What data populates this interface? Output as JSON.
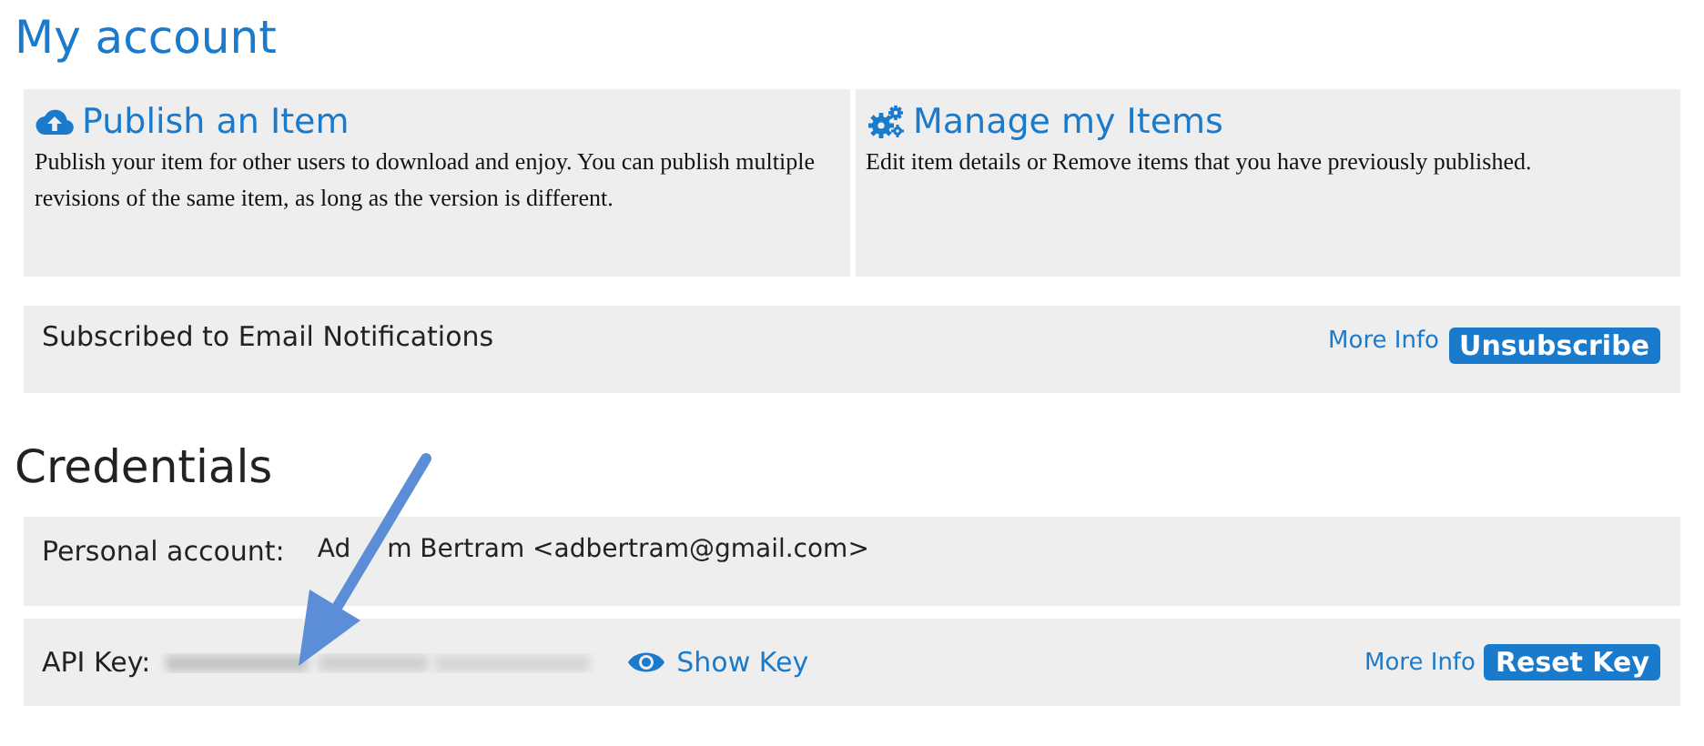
{
  "page_title": "My account",
  "cards": [
    {
      "kind": "upload",
      "title": "Publish an Item",
      "description": "Publish your item for other users to download and enjoy. You can publish multiple revisions of the same item, as long as the version is different."
    },
    {
      "kind": "gears",
      "title": "Manage my Items",
      "description": "Edit item details or Remove items that you have previously published."
    }
  ],
  "notifications": {
    "label": "Subscribed to Email Notifications",
    "link": "More Info",
    "button": "Unsubscribe"
  },
  "credentials": {
    "heading": "Credentials",
    "personal": {
      "label": "Personal account:",
      "value_parts": [
        "Ad",
        "m Bertram <adbertram@gmail.com>"
      ]
    },
    "api_key": {
      "label": "API Key:",
      "show_link": "Show Key",
      "link": "More Info",
      "button": "Reset Key"
    }
  }
}
